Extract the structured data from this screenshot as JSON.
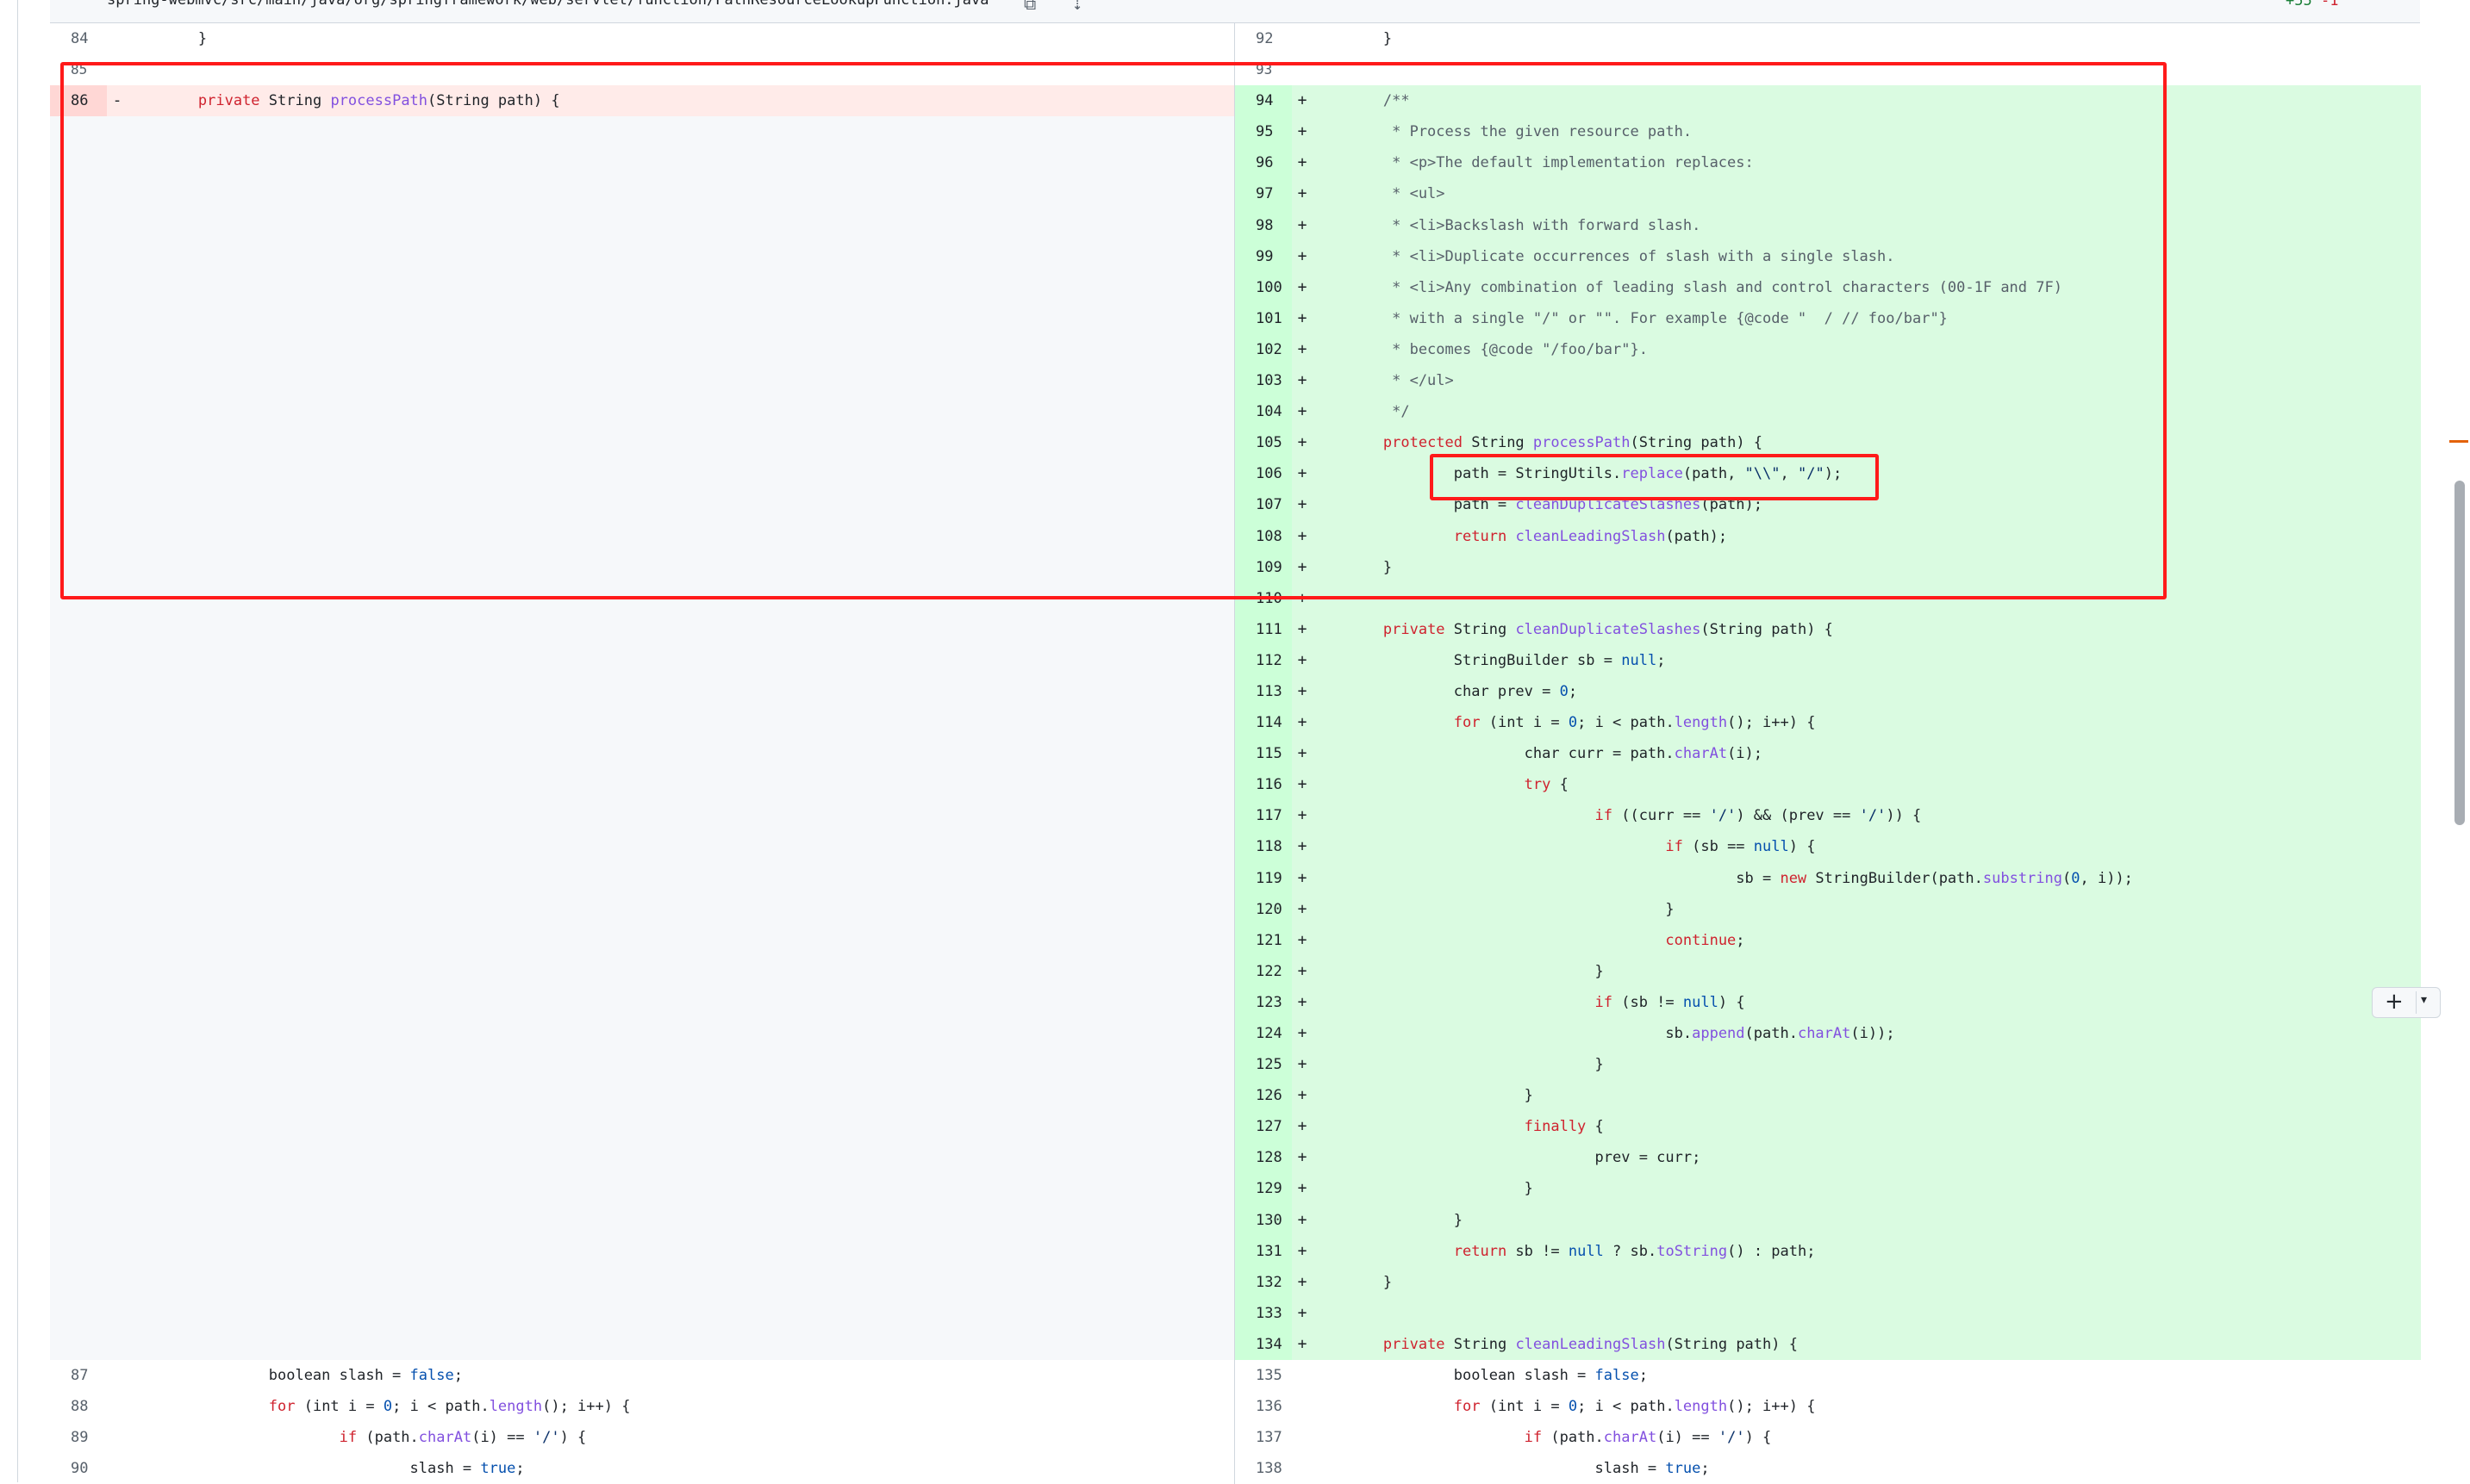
{
  "file_header": {
    "path": "spring-webmvc/src/main/java/org/springframework/web/servlet/function/PathResourceLookupFunction.java",
    "additions": "+55",
    "deletions": "-1"
  },
  "diff_rows": [
    {
      "type": "context",
      "left_num": "84",
      "right_num": "92",
      "left_code": [
        [
          "",
          "        }"
        ]
      ],
      "right_code": [
        [
          "",
          "        }"
        ]
      ]
    },
    {
      "type": "context",
      "left_num": "85",
      "right_num": "93",
      "left_code": [],
      "right_code": []
    },
    {
      "type": "change",
      "left_num": "86",
      "left_mark": "-",
      "left_code": [
        [
          "",
          "        "
        ],
        [
          "kw",
          "private"
        ],
        [
          "",
          " String "
        ],
        [
          "fn",
          "processPath"
        ],
        [
          "",
          "(String path) {"
        ]
      ],
      "right_num": "94",
      "right_mark": "+",
      "right_code": [
        [
          "",
          "        "
        ],
        [
          "cm",
          "/**"
        ]
      ]
    },
    {
      "type": "add",
      "right_num": "95",
      "right_mark": "+",
      "right_code": [
        [
          "cm",
          "         * Process the given resource path."
        ]
      ]
    },
    {
      "type": "add",
      "right_num": "96",
      "right_mark": "+",
      "right_code": [
        [
          "cm",
          "         * <p>The default implementation replaces:"
        ]
      ]
    },
    {
      "type": "add",
      "right_num": "97",
      "right_mark": "+",
      "right_code": [
        [
          "cm",
          "         * <ul>"
        ]
      ]
    },
    {
      "type": "add",
      "right_num": "98",
      "right_mark": "+",
      "right_code": [
        [
          "cm",
          "         * <li>Backslash with forward slash."
        ]
      ]
    },
    {
      "type": "add",
      "right_num": "99",
      "right_mark": "+",
      "right_code": [
        [
          "cm",
          "         * <li>Duplicate occurrences of slash with a single slash."
        ]
      ]
    },
    {
      "type": "add",
      "right_num": "100",
      "right_mark": "+",
      "right_code": [
        [
          "cm",
          "         * <li>Any combination of leading slash and control characters (00-1F and 7F)"
        ]
      ]
    },
    {
      "type": "add",
      "right_num": "101",
      "right_mark": "+",
      "right_code": [
        [
          "cm",
          "         * with a single \"/\" or \"\". For example {@code \"  / // foo/bar\"}"
        ]
      ]
    },
    {
      "type": "add",
      "right_num": "102",
      "right_mark": "+",
      "right_code": [
        [
          "cm",
          "         * becomes {@code \"/foo/bar\"}."
        ]
      ]
    },
    {
      "type": "add",
      "right_num": "103",
      "right_mark": "+",
      "right_code": [
        [
          "cm",
          "         * </ul>"
        ]
      ]
    },
    {
      "type": "add",
      "right_num": "104",
      "right_mark": "+",
      "right_code": [
        [
          "cm",
          "         */"
        ]
      ]
    },
    {
      "type": "add",
      "right_num": "105",
      "right_mark": "+",
      "right_code": [
        [
          "",
          "        "
        ],
        [
          "kw",
          "protected"
        ],
        [
          "",
          " String "
        ],
        [
          "fn",
          "processPath"
        ],
        [
          "",
          "(String path) {"
        ]
      ]
    },
    {
      "type": "add",
      "right_num": "106",
      "right_mark": "+",
      "right_code": [
        [
          "",
          "                path = StringUtils."
        ],
        [
          "fn",
          "replace"
        ],
        [
          "",
          "(path, "
        ],
        [
          "str",
          "\"\\\\\""
        ],
        [
          "",
          ", "
        ],
        [
          "str",
          "\"/\""
        ],
        [
          "",
          ");"
        ]
      ]
    },
    {
      "type": "add",
      "right_num": "107",
      "right_mark": "+",
      "right_code": [
        [
          "",
          "                path = "
        ],
        [
          "fn",
          "cleanDuplicateSlashes"
        ],
        [
          "",
          "(path);"
        ]
      ]
    },
    {
      "type": "add",
      "right_num": "108",
      "right_mark": "+",
      "right_code": [
        [
          "",
          "                "
        ],
        [
          "kw",
          "return"
        ],
        [
          "",
          " "
        ],
        [
          "fn",
          "cleanLeadingSlash"
        ],
        [
          "",
          "(path);"
        ]
      ]
    },
    {
      "type": "add",
      "right_num": "109",
      "right_mark": "+",
      "right_code": [
        [
          "",
          "        }"
        ]
      ]
    },
    {
      "type": "add",
      "right_num": "110",
      "right_mark": "+",
      "right_code": []
    },
    {
      "type": "add",
      "right_num": "111",
      "right_mark": "+",
      "right_code": [
        [
          "",
          "        "
        ],
        [
          "kw",
          "private"
        ],
        [
          "",
          " String "
        ],
        [
          "fn",
          "cleanDuplicateSlashes"
        ],
        [
          "",
          "(String path) {"
        ]
      ]
    },
    {
      "type": "add",
      "right_num": "112",
      "right_mark": "+",
      "right_code": [
        [
          "",
          "                StringBuilder sb = "
        ],
        [
          "cn",
          "null"
        ],
        [
          "",
          ";"
        ]
      ]
    },
    {
      "type": "add",
      "right_num": "113",
      "right_mark": "+",
      "right_code": [
        [
          "",
          "                char prev = "
        ],
        [
          "cn",
          "0"
        ],
        [
          "",
          ";"
        ]
      ]
    },
    {
      "type": "add",
      "right_num": "114",
      "right_mark": "+",
      "right_code": [
        [
          "",
          "                "
        ],
        [
          "kw",
          "for"
        ],
        [
          "",
          " (int i = "
        ],
        [
          "cn",
          "0"
        ],
        [
          "",
          "; i < path."
        ],
        [
          "fn",
          "length"
        ],
        [
          "",
          "(); i++) {"
        ]
      ]
    },
    {
      "type": "add",
      "right_num": "115",
      "right_mark": "+",
      "right_code": [
        [
          "",
          "                        char curr = path."
        ],
        [
          "fn",
          "charAt"
        ],
        [
          "",
          "(i);"
        ]
      ]
    },
    {
      "type": "add",
      "right_num": "116",
      "right_mark": "+",
      "right_code": [
        [
          "",
          "                        "
        ],
        [
          "kw",
          "try"
        ],
        [
          "",
          " {"
        ]
      ]
    },
    {
      "type": "add",
      "right_num": "117",
      "right_mark": "+",
      "right_code": [
        [
          "",
          "                                "
        ],
        [
          "kw",
          "if"
        ],
        [
          "",
          " ((curr == "
        ],
        [
          "str",
          "'/'"
        ],
        [
          "",
          ") && (prev == "
        ],
        [
          "str",
          "'/'"
        ],
        [
          "",
          ")) {"
        ]
      ]
    },
    {
      "type": "add",
      "right_num": "118",
      "right_mark": "+",
      "right_code": [
        [
          "",
          "                                        "
        ],
        [
          "kw",
          "if"
        ],
        [
          "",
          " (sb == "
        ],
        [
          "cn",
          "null"
        ],
        [
          "",
          ") {"
        ]
      ]
    },
    {
      "type": "add",
      "right_num": "119",
      "right_mark": "+",
      "right_code": [
        [
          "",
          "                                                sb = "
        ],
        [
          "kw",
          "new"
        ],
        [
          "",
          " StringBuilder(path."
        ],
        [
          "fn",
          "substring"
        ],
        [
          "",
          "("
        ],
        [
          "cn",
          "0"
        ],
        [
          "",
          ", i));"
        ]
      ]
    },
    {
      "type": "add",
      "right_num": "120",
      "right_mark": "+",
      "right_code": [
        [
          "",
          "                                        }"
        ]
      ]
    },
    {
      "type": "add",
      "right_num": "121",
      "right_mark": "+",
      "right_code": [
        [
          "",
          "                                        "
        ],
        [
          "kw",
          "continue"
        ],
        [
          "",
          ";"
        ]
      ]
    },
    {
      "type": "add",
      "right_num": "122",
      "right_mark": "+",
      "right_code": [
        [
          "",
          "                                }"
        ]
      ]
    },
    {
      "type": "add",
      "right_num": "123",
      "right_mark": "+",
      "right_code": [
        [
          "",
          "                                "
        ],
        [
          "kw",
          "if"
        ],
        [
          "",
          " (sb != "
        ],
        [
          "cn",
          "null"
        ],
        [
          "",
          ") {"
        ]
      ]
    },
    {
      "type": "add",
      "right_num": "124",
      "right_mark": "+",
      "right_code": [
        [
          "",
          "                                        sb."
        ],
        [
          "fn",
          "append"
        ],
        [
          "",
          "(path."
        ],
        [
          "fn",
          "charAt"
        ],
        [
          "",
          "(i));"
        ]
      ]
    },
    {
      "type": "add",
      "right_num": "125",
      "right_mark": "+",
      "right_code": [
        [
          "",
          "                                }"
        ]
      ]
    },
    {
      "type": "add",
      "right_num": "126",
      "right_mark": "+",
      "right_code": [
        [
          "",
          "                        }"
        ]
      ]
    },
    {
      "type": "add",
      "right_num": "127",
      "right_mark": "+",
      "right_code": [
        [
          "",
          "                        "
        ],
        [
          "kw",
          "finally"
        ],
        [
          "",
          " {"
        ]
      ]
    },
    {
      "type": "add",
      "right_num": "128",
      "right_mark": "+",
      "right_code": [
        [
          "",
          "                                prev = curr;"
        ]
      ]
    },
    {
      "type": "add",
      "right_num": "129",
      "right_mark": "+",
      "right_code": [
        [
          "",
          "                        }"
        ]
      ]
    },
    {
      "type": "add",
      "right_num": "130",
      "right_mark": "+",
      "right_code": [
        [
          "",
          "                }"
        ]
      ]
    },
    {
      "type": "add",
      "right_num": "131",
      "right_mark": "+",
      "right_code": [
        [
          "",
          "                "
        ],
        [
          "kw",
          "return"
        ],
        [
          "",
          " sb != "
        ],
        [
          "cn",
          "null"
        ],
        [
          "",
          " ? sb."
        ],
        [
          "fn",
          "toString"
        ],
        [
          "",
          "() : path;"
        ]
      ]
    },
    {
      "type": "add",
      "right_num": "132",
      "right_mark": "+",
      "right_code": [
        [
          "",
          "        }"
        ]
      ]
    },
    {
      "type": "add",
      "right_num": "133",
      "right_mark": "+",
      "right_code": []
    },
    {
      "type": "add",
      "right_num": "134",
      "right_mark": "+",
      "right_code": [
        [
          "",
          "        "
        ],
        [
          "kw",
          "private"
        ],
        [
          "",
          " String "
        ],
        [
          "fn",
          "cleanLeadingSlash"
        ],
        [
          "",
          "(String path) {"
        ]
      ]
    },
    {
      "type": "context",
      "left_num": "87",
      "right_num": "135",
      "left_code": [
        [
          "",
          "                boolean slash = "
        ],
        [
          "cn",
          "false"
        ],
        [
          "",
          ";"
        ]
      ],
      "right_code": [
        [
          "",
          "                boolean slash = "
        ],
        [
          "cn",
          "false"
        ],
        [
          "",
          ";"
        ]
      ]
    },
    {
      "type": "context",
      "left_num": "88",
      "right_num": "136",
      "left_code": [
        [
          "",
          "                "
        ],
        [
          "kw",
          "for"
        ],
        [
          "",
          " (int i = "
        ],
        [
          "cn",
          "0"
        ],
        [
          "",
          "; i < path."
        ],
        [
          "fn",
          "length"
        ],
        [
          "",
          "(); i++) {"
        ]
      ],
      "right_code": [
        [
          "",
          "                "
        ],
        [
          "kw",
          "for"
        ],
        [
          "",
          " (int i = "
        ],
        [
          "cn",
          "0"
        ],
        [
          "",
          "; i < path."
        ],
        [
          "fn",
          "length"
        ],
        [
          "",
          "(); i++) {"
        ]
      ]
    },
    {
      "type": "context",
      "left_num": "89",
      "right_num": "137",
      "left_code": [
        [
          "",
          "                        "
        ],
        [
          "kw",
          "if"
        ],
        [
          "",
          " (path."
        ],
        [
          "fn",
          "charAt"
        ],
        [
          "",
          "(i) == "
        ],
        [
          "str",
          "'/'"
        ],
        [
          "",
          ") {"
        ]
      ],
      "right_code": [
        [
          "",
          "                        "
        ],
        [
          "kw",
          "if"
        ],
        [
          "",
          " (path."
        ],
        [
          "fn",
          "charAt"
        ],
        [
          "",
          "(i) == "
        ],
        [
          "str",
          "'/'"
        ],
        [
          "",
          ") {"
        ]
      ]
    },
    {
      "type": "context",
      "left_num": "90",
      "right_num": "138",
      "left_code": [
        [
          "",
          "                                slash = "
        ],
        [
          "cn",
          "true"
        ],
        [
          "",
          ";"
        ]
      ],
      "right_code": [
        [
          "",
          "                                slash = "
        ],
        [
          "cn",
          "true"
        ],
        [
          "",
          ";"
        ]
      ]
    }
  ],
  "colors": {
    "deletion_bg": "#ffebe9",
    "addition_bg": "#dafbe1",
    "highlight_box": "#ff1a1a"
  },
  "icons": [
    "copy-icon",
    "expand-icon",
    "plus-icon",
    "chevron-down-icon"
  ]
}
